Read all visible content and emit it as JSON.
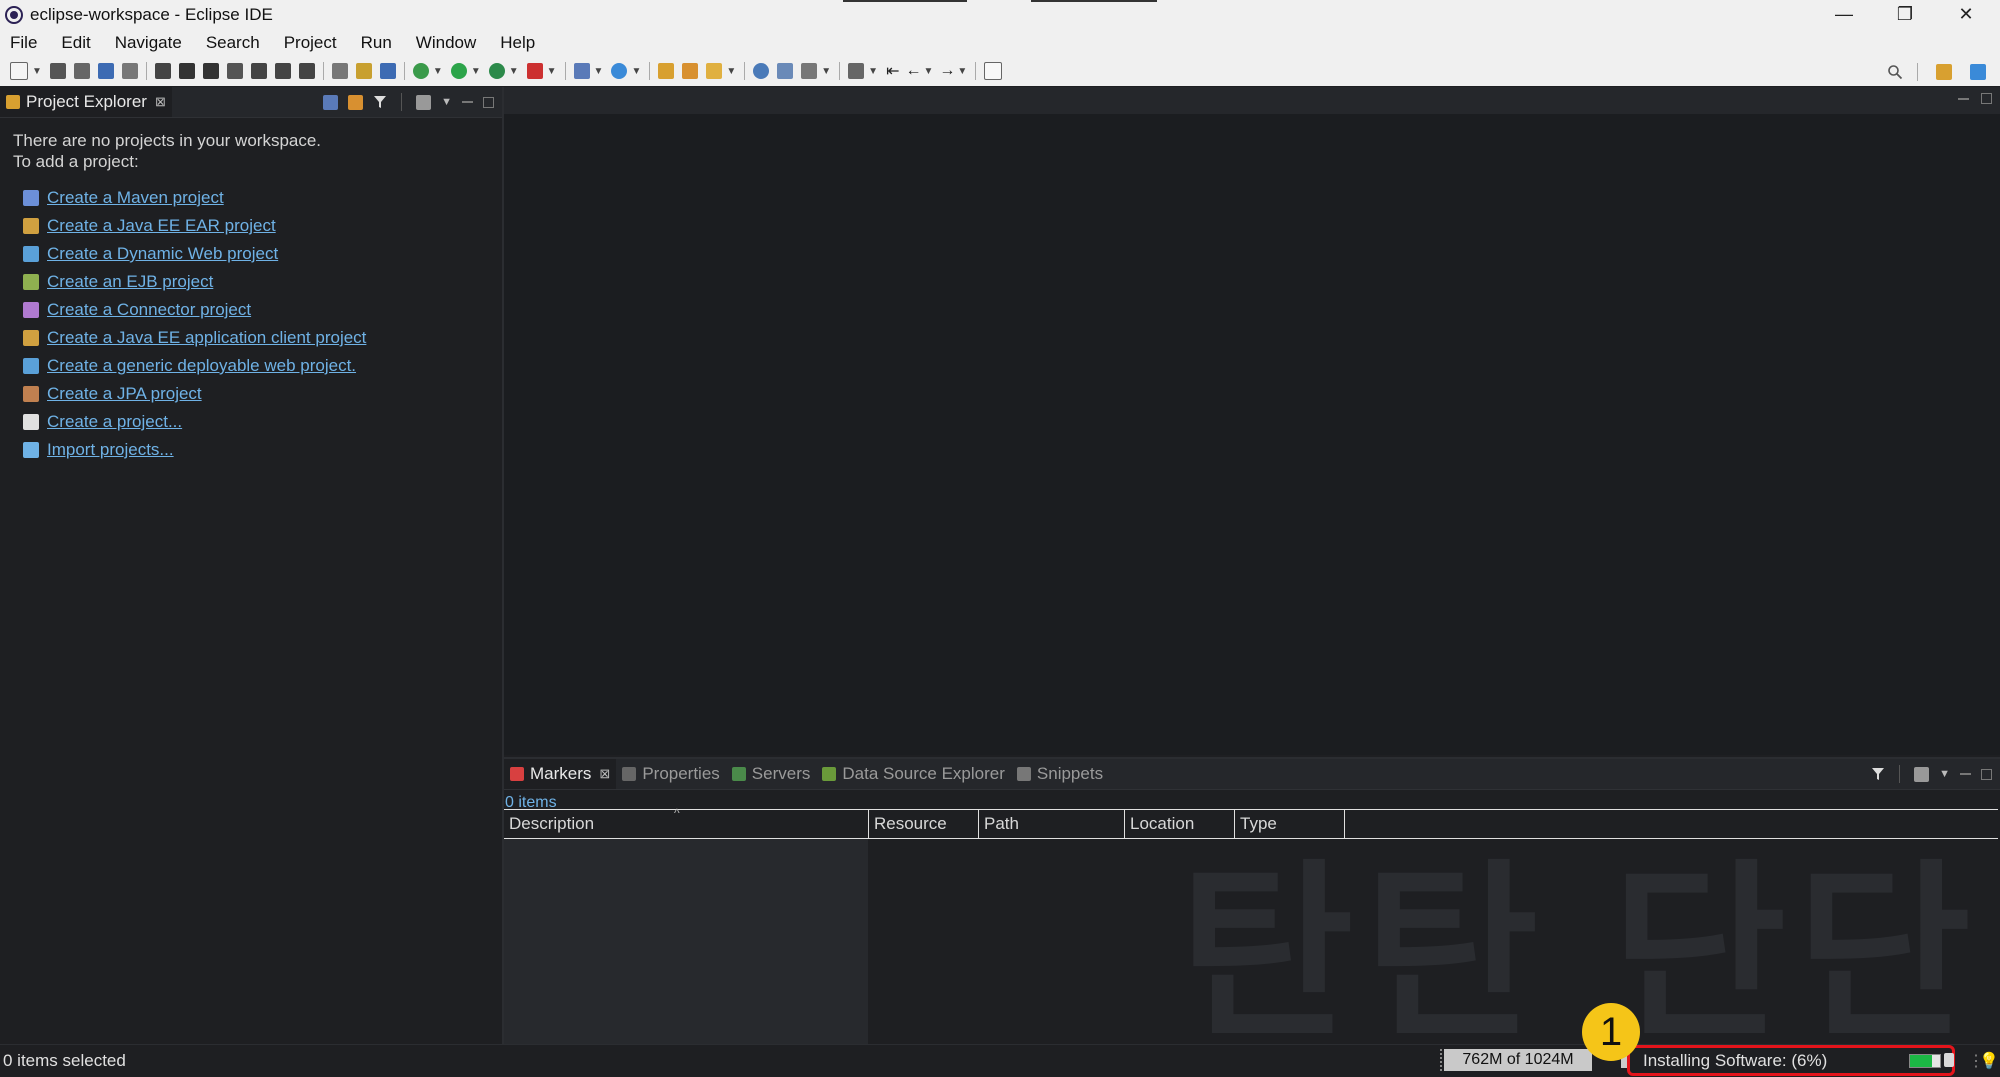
{
  "window": {
    "title": "eclipse-workspace - Eclipse IDE",
    "controls": [
      "—",
      "❐",
      "✕"
    ]
  },
  "menubar": [
    "File",
    "Edit",
    "Navigate",
    "Search",
    "Project",
    "Run",
    "Window",
    "Help"
  ],
  "project_explorer": {
    "tab_label": "Project Explorer",
    "empty_message_line1": "There are no projects in your workspace.",
    "empty_message_line2": "To add a project:",
    "links": [
      {
        "label": "Create a Maven project",
        "icon": "maven-icon",
        "color": "#6c8fd8"
      },
      {
        "label": "Create a Java EE EAR project",
        "icon": "ear-project-icon",
        "color": "#d0a040"
      },
      {
        "label": "Create a Dynamic Web project",
        "icon": "web-project-icon",
        "color": "#5aa0d8"
      },
      {
        "label": "Create an EJB project",
        "icon": "ejb-project-icon",
        "color": "#8fb050"
      },
      {
        "label": "Create a Connector project",
        "icon": "connector-project-icon",
        "color": "#b07ad0"
      },
      {
        "label": "Create a Java EE application client project",
        "icon": "client-project-icon",
        "color": "#d0a040"
      },
      {
        "label": "Create a generic deployable web project.",
        "icon": "generic-web-icon",
        "color": "#5aa0d8"
      },
      {
        "label": "Create a JPA project",
        "icon": "jpa-project-icon",
        "color": "#c08050"
      },
      {
        "label": "Create a project...",
        "icon": "new-project-icon",
        "color": "#e0e0e0"
      },
      {
        "label": "Import projects...",
        "icon": "import-icon",
        "color": "#6fb2e6"
      }
    ]
  },
  "bottom_panel": {
    "tabs": [
      {
        "label": "Markers",
        "active": true
      },
      {
        "label": "Properties",
        "active": false
      },
      {
        "label": "Servers",
        "active": false
      },
      {
        "label": "Data Source Explorer",
        "active": false
      },
      {
        "label": "Snippets",
        "active": false
      }
    ],
    "items_count": "0 items",
    "columns": [
      {
        "label": "Description"
      },
      {
        "label": "Resource"
      },
      {
        "label": "Path"
      },
      {
        "label": "Location"
      },
      {
        "label": "Type"
      }
    ],
    "watermark": "탄탄 단단"
  },
  "statusbar": {
    "selection": "0 items selected",
    "heap": "762M of 1024M",
    "progress_label": "Installing Software: (6%)",
    "progress_fraction": 0.06
  },
  "annotation": {
    "badge_number": "1",
    "highlight_color": "#e4141b",
    "badge_color": "#f5c518"
  },
  "colors": {
    "link": "#6fb2e6",
    "progress_fill": "#1cb845"
  }
}
